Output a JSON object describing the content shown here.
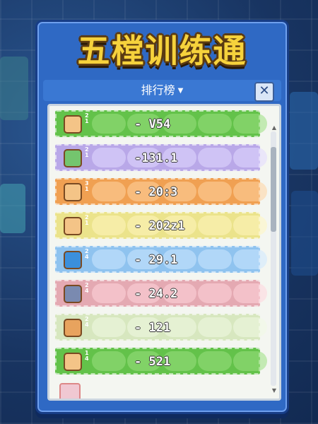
{
  "title": "五樘训练通",
  "subtitle": "排行榜",
  "close_label": "✕",
  "rows": [
    {
      "score": "- V54",
      "rank_text": "2 1",
      "color": "#63c24a",
      "pill": "#9be07f",
      "icon": "pudding-icon",
      "icon_color": "#f4c487"
    },
    {
      "score": "-131.1",
      "rank_text": "2 1",
      "color": "#b9a8e8",
      "pill": "#e1d8ff",
      "icon": "sword-slime-icon",
      "icon_color": "#74c56e"
    },
    {
      "score": "- 20:3",
      "rank_text": "3 1",
      "color": "#f0a052",
      "pill": "#ffd4a1",
      "icon": "pudding-icon",
      "icon_color": "#f4c487"
    },
    {
      "score": "- 202z1",
      "rank_text": "2 1",
      "color": "#ebe38b",
      "pill": "#fff6bf",
      "icon": "pudding-icon",
      "icon_color": "#f4c487"
    },
    {
      "score": "- 29.1",
      "rank_text": "2 4",
      "color": "#8fc3ef",
      "pill": "#cde7ff",
      "icon": "signpost-icon",
      "icon_color": "#3b8fdc"
    },
    {
      "score": "- 24.2",
      "rank_text": "2 4",
      "color": "#e4a9b2",
      "pill": "#ffd6dc",
      "icon": "robot-icon",
      "icon_color": "#7a8ab0"
    },
    {
      "score": "- 121",
      "rank_text": "2 4",
      "color": "#d7e7bf",
      "pill": "#f0f9e3",
      "icon": "pudding-icon",
      "icon_color": "#e8a35e"
    },
    {
      "score": "- 521",
      "rank_text": "1 4",
      "color": "#63c24a",
      "pill": "#9be07f",
      "icon": "pudding-icon",
      "icon_color": "#f4c487"
    }
  ],
  "colors": {
    "panel": "#2f69c4",
    "title": "#f6d23c"
  }
}
